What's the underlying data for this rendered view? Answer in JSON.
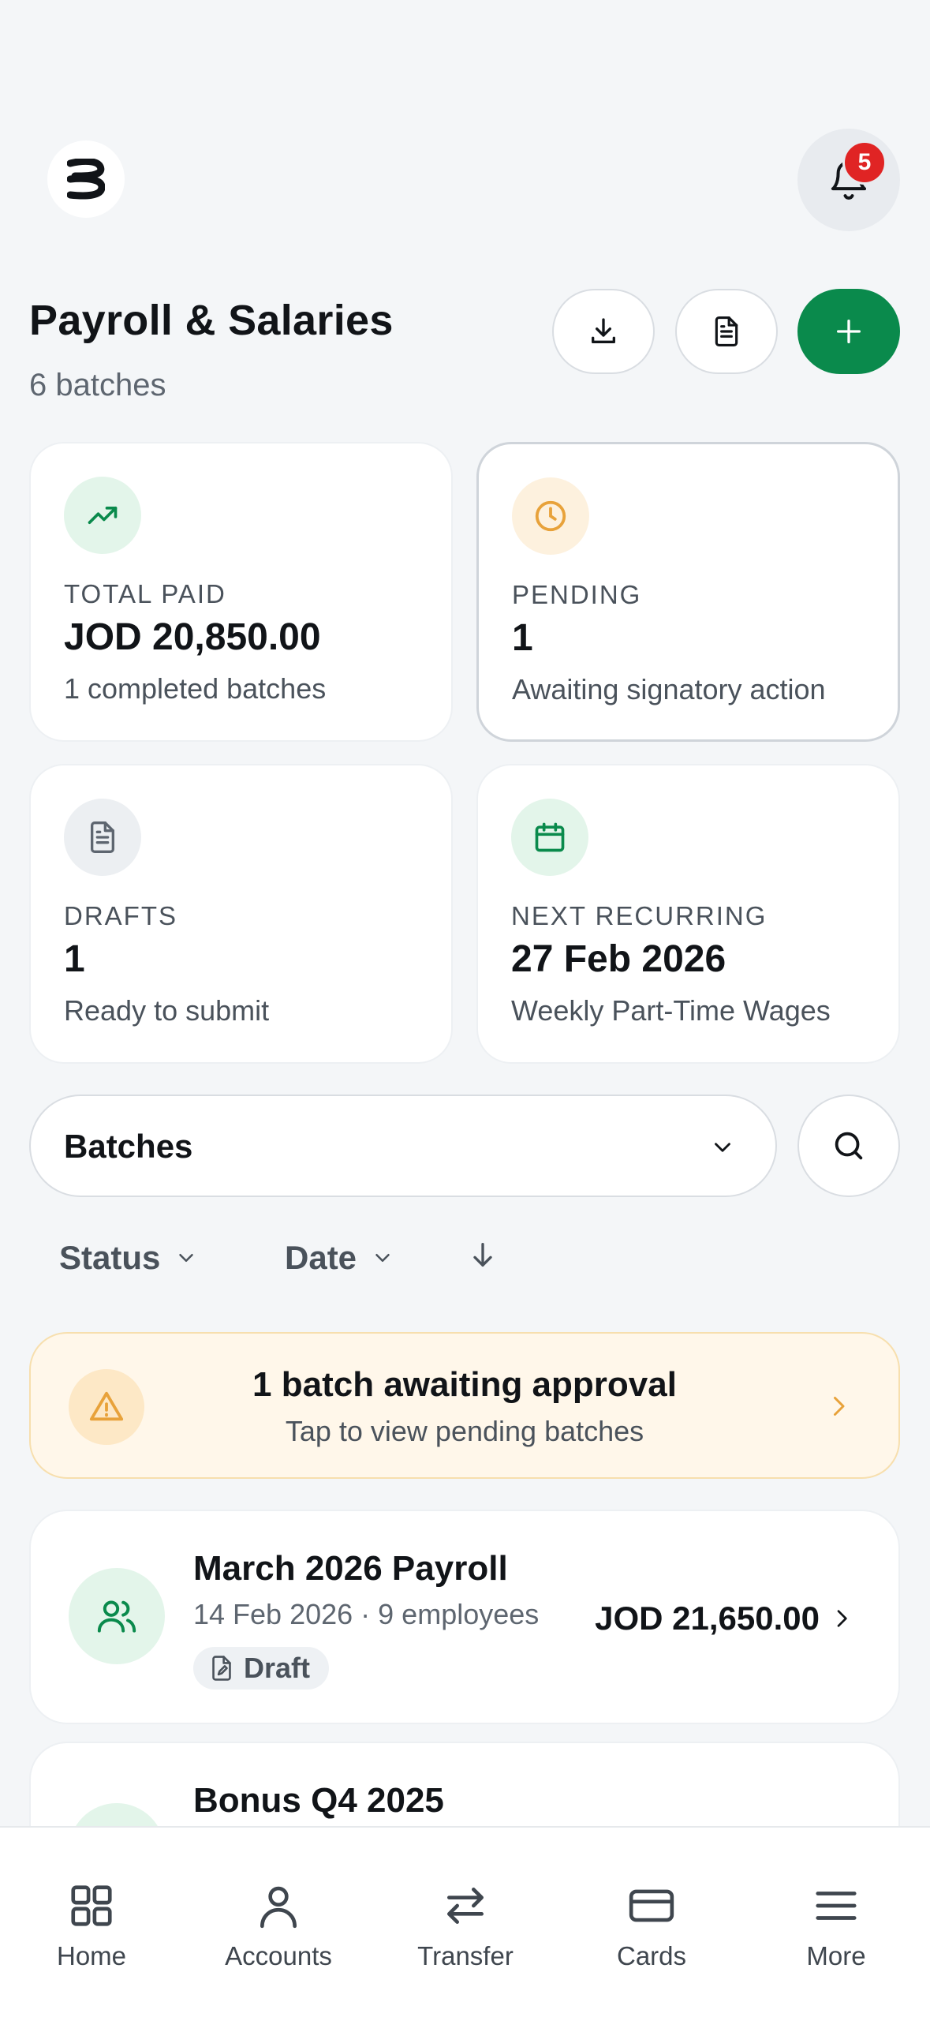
{
  "header": {
    "notification_count": "5",
    "title": "Payroll & Salaries",
    "subtitle": "6 batches"
  },
  "stats": [
    {
      "label": "TOTAL PAID",
      "value": "JOD 20,850.00",
      "sub": "1 completed batches",
      "icon": "trending-up-icon",
      "icon_color": "#0a8a4c",
      "icon_bg": "#e3f5ea"
    },
    {
      "label": "PENDING",
      "value": "1",
      "sub": "Awaiting signatory action",
      "icon": "clock-icon",
      "icon_color": "#e8a23a",
      "icon_bg": "#fdf1de"
    },
    {
      "label": "DRAFTS",
      "value": "1",
      "sub": "Ready to submit",
      "icon": "document-icon",
      "icon_color": "#5e6670",
      "icon_bg": "#eceff2"
    },
    {
      "label": "NEXT RECURRING",
      "value": "27 Feb 2026",
      "sub": "Weekly Part-Time Wages",
      "icon": "calendar-icon",
      "icon_color": "#0a8a4c",
      "icon_bg": "#e3f5ea"
    }
  ],
  "selector": {
    "value": "Batches"
  },
  "filters": {
    "status": "Status",
    "date": "Date"
  },
  "banner": {
    "title": "1 batch awaiting approval",
    "subtitle": "Tap to view pending batches"
  },
  "batches": [
    {
      "name": "March 2026 Payroll",
      "meta": "14 Feb 2026 · 9 employees",
      "status": "Draft",
      "amount": "JOD 21,650.00"
    },
    {
      "name": "Bonus Q4 2025"
    }
  ],
  "nav": [
    {
      "label": "Home"
    },
    {
      "label": "Accounts"
    },
    {
      "label": "Transfer"
    },
    {
      "label": "Cards"
    },
    {
      "label": "More"
    }
  ],
  "colors": {
    "brand_green": "#0a8a4c",
    "badge_red": "#e02424",
    "warning": "#e8a23a"
  }
}
